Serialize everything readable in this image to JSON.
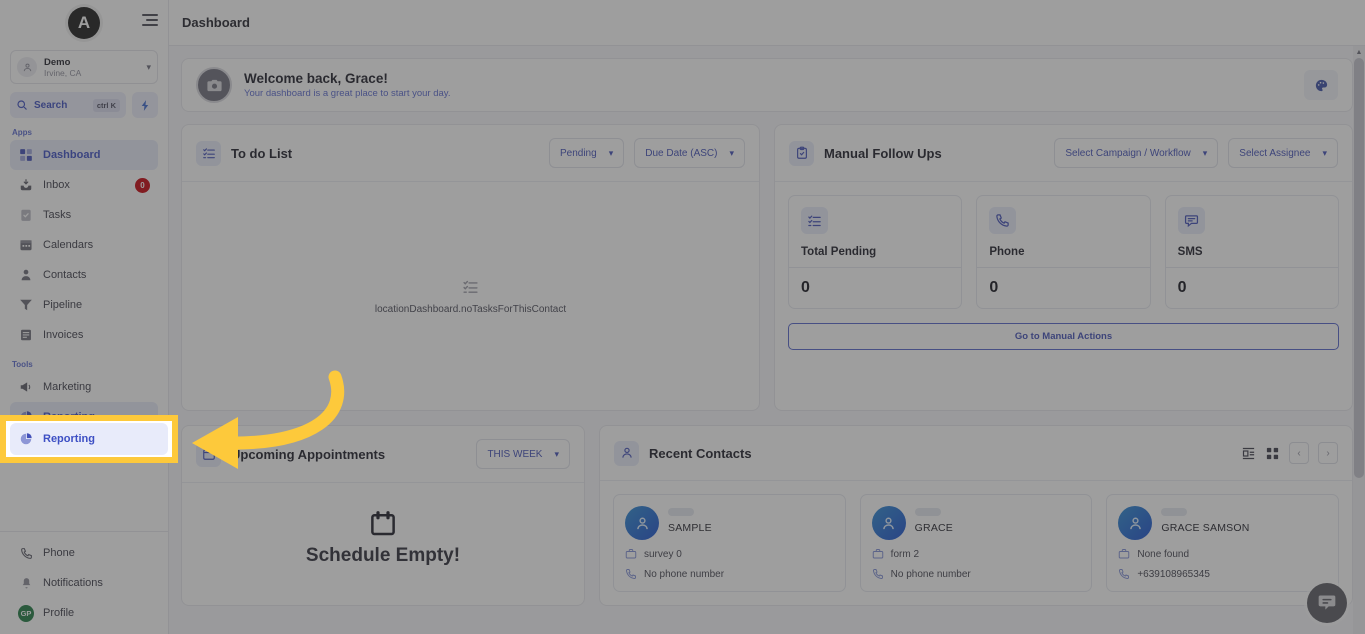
{
  "sidebar": {
    "logo_letter": "A",
    "location": {
      "name": "Demo",
      "sub": "Irvine, CA"
    },
    "search": {
      "label": "Search",
      "shortcut": "ctrl K"
    },
    "sections": [
      {
        "label": "Apps"
      },
      {
        "label": "Tools"
      }
    ],
    "apps": [
      {
        "label": "Dashboard",
        "icon": "grid-icon",
        "active": true,
        "badge": ""
      },
      {
        "label": "Inbox",
        "icon": "inbox-icon",
        "active": false,
        "badge": "0"
      },
      {
        "label": "Tasks",
        "icon": "tasks-icon",
        "active": false,
        "badge": ""
      },
      {
        "label": "Calendars",
        "icon": "calendar-icon",
        "active": false,
        "badge": ""
      },
      {
        "label": "Contacts",
        "icon": "contacts-icon",
        "active": false,
        "badge": ""
      },
      {
        "label": "Pipeline",
        "icon": "pipeline-icon",
        "active": false,
        "badge": ""
      },
      {
        "label": "Invoices",
        "icon": "invoices-icon",
        "active": false,
        "badge": ""
      }
    ],
    "tools": [
      {
        "label": "Marketing",
        "icon": "megaphone-icon",
        "active": false
      },
      {
        "label": "Reporting",
        "icon": "pie-chart-icon",
        "active": true
      }
    ],
    "bottom": [
      {
        "label": "Phone",
        "icon": "phone-icon"
      },
      {
        "label": "Notifications",
        "icon": "bell-icon"
      },
      {
        "label": "Profile",
        "icon": "avatar-gp",
        "initials": "GP"
      }
    ]
  },
  "topbar": {
    "title": "Dashboard"
  },
  "welcome": {
    "title": "Welcome back, Grace!",
    "subtitle": "Your dashboard is a great place to start your day.",
    "avatar_icon": "camera-icon",
    "action_icon": "palette-icon"
  },
  "todo": {
    "title": "To do List",
    "filter_status": "Pending",
    "filter_sort": "Due Date (ASC)",
    "empty_text": "locationDashboard.noTasksForThisContact"
  },
  "manual_follow_ups": {
    "title": "Manual Follow Ups",
    "filter_campaign": "Select Campaign / Workflow",
    "filter_assignee": "Select Assignee",
    "stats": [
      {
        "label": "Total Pending",
        "value": "0",
        "icon": "list-check-icon"
      },
      {
        "label": "Phone",
        "value": "0",
        "icon": "phone-icon"
      },
      {
        "label": "SMS",
        "value": "0",
        "icon": "sms-icon"
      }
    ],
    "action_label": "Go to Manual Actions"
  },
  "appointments": {
    "title": "Upcoming Appointments",
    "filter_range": "THIS WEEK",
    "empty_title": "Schedule Empty!"
  },
  "recent_contacts": {
    "title": "Recent Contacts",
    "view_list_icon": "list-view-icon",
    "view_grid_icon": "grid-view-icon",
    "prev_label": "‹",
    "next_label": "›",
    "contacts": [
      {
        "name": "SAMPLE",
        "source": "survey 0",
        "phone": "No phone number"
      },
      {
        "name": "GRACE",
        "source": "form 2",
        "phone": "No phone number"
      },
      {
        "name": "GRACE SAMSON",
        "source": "None found",
        "phone": "+639108965345"
      }
    ]
  },
  "chat_widget": {
    "icon": "chat-bubble-icon"
  },
  "annotation": {
    "highlight_target": "Reporting",
    "highlight_color": "#fdc93b",
    "arrow_color": "#fdc93b"
  },
  "colors": {
    "accent": "#4250b8",
    "accent_bg": "#e8ebfa",
    "badge_red": "#c7000b",
    "highlight_yellow": "#fdc93b",
    "avatar_green": "#1e7a42"
  }
}
